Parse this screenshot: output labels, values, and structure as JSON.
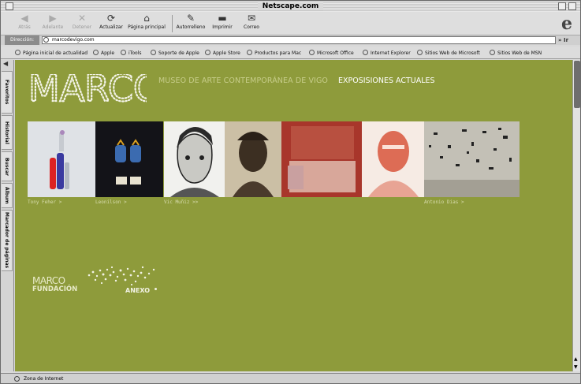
{
  "window": {
    "title": "Netscape.com"
  },
  "toolbar": {
    "back": "Atrás",
    "forward": "Adelante",
    "stop": "Detener",
    "reload": "Actualizar",
    "home": "Página principal",
    "autofill": "Autorrelleno",
    "print": "Imprimir",
    "mail": "Correo"
  },
  "address": {
    "label": "Dirección:",
    "url": "marcodevigo.com",
    "go": "Ir"
  },
  "favorites": [
    "Página inicial de actualidad",
    "Apple",
    "iTools",
    "Soporte de Apple",
    "Apple Store",
    "Productos para Mac",
    "Microsoft Office",
    "Internet Explorer",
    "Sitios Web de Microsoft",
    "Sitios Web de MSN"
  ],
  "sidebar_tabs": [
    "Favoritos",
    "Historial",
    "Buscar",
    "Álbum",
    "Marcador de páginas"
  ],
  "site": {
    "logo": "MARCO",
    "subtitle": "MUSEO DE ARTE CONTEMPORÁNEA DE VIGO",
    "section": "EXPOSISIONES ACTUALES",
    "captions": {
      "c1": "Tony Feher >",
      "c2": "Leonilson >",
      "c3": "Vic Muñiz >>",
      "c4": "Antonio Dias >"
    },
    "fundacion_1": "MARCO",
    "fundacion_2": "FUNDACIÓN",
    "anexo": "ANEXO"
  },
  "status": {
    "text": "Zona de Internet"
  },
  "colors": {
    "page_bg": "#8e9b3b",
    "accent_text": "#c7cd8a"
  }
}
